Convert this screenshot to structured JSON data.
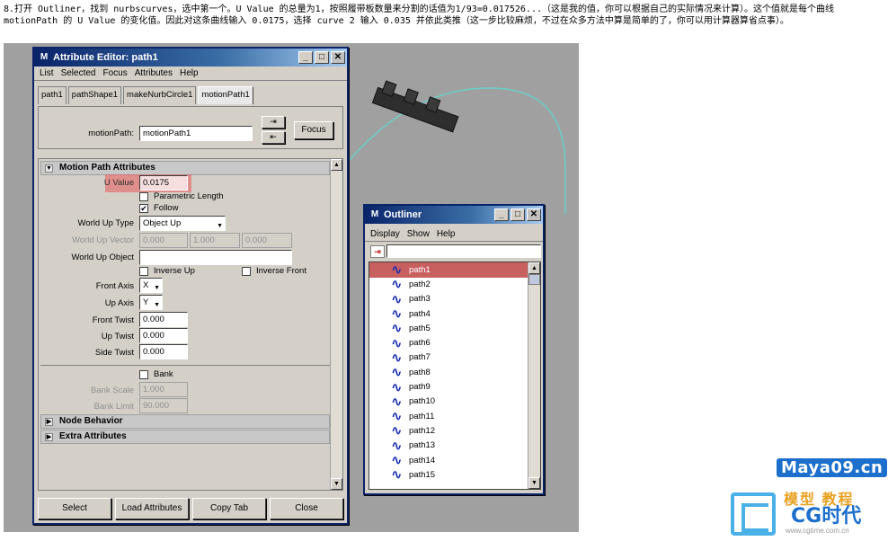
{
  "intro_text": "8.打开 Outliner，找到 nurbscurves，选中第一个。U Value 的总量为1，按照履带板数量来分割的话值为1/93=0.017526...（这是我的值，你可以根据自己的实际情况来计算）。这个值就是每个曲线 motionPath 的 U Value 的变化值。因此对这条曲线输入 0.0175，选择 curve 2 输入 0.035 并依此类推（这一步比较麻烦，不过在众多方法中算是简单的了，你可以用计算器算省点事）。",
  "attr_editor": {
    "title": "Attribute Editor: path1",
    "menu": [
      "List",
      "Selected",
      "Focus",
      "Attributes",
      "Help"
    ],
    "tabs": [
      "path1",
      "pathShape1",
      "makeNurbCircle1",
      "motionPath1"
    ],
    "active_tab": "motionPath1",
    "motion_path_label": "motionPath:",
    "motion_path_value": "motionPath1",
    "focus_button": "Focus",
    "section_motion": "Motion Path Attributes",
    "u_value_label": "U Value",
    "u_value": "0.0175",
    "parametric_length": "Parametric Length",
    "follow": "Follow",
    "world_up_type_label": "World Up Type",
    "world_up_type_value": "Object Up",
    "world_up_vector_label": "World Up Vector",
    "world_up_vector": [
      "0.000",
      "1.000",
      "0.000"
    ],
    "world_up_object_label": "World Up Object",
    "inverse_up": "Inverse Up",
    "inverse_front": "Inverse Front",
    "front_axis_label": "Front Axis",
    "front_axis_value": "X",
    "up_axis_label": "Up Axis",
    "up_axis_value": "Y",
    "front_twist_label": "Front Twist",
    "front_twist": "0.000",
    "up_twist_label": "Up Twist",
    "up_twist": "0.000",
    "side_twist_label": "Side Twist",
    "side_twist": "0.000",
    "bank": "Bank",
    "bank_scale_label": "Bank Scale",
    "bank_scale": "1.000",
    "bank_limit_label": "Bank Limit",
    "bank_limit": "90.000",
    "section_node": "Node Behavior",
    "section_extra": "Extra Attributes",
    "buttons": [
      "Select",
      "Load Attributes",
      "Copy Tab",
      "Close"
    ]
  },
  "outliner": {
    "title": "Outliner",
    "menu": [
      "Display",
      "Show",
      "Help"
    ],
    "items": [
      "path1",
      "path2",
      "path3",
      "path4",
      "path5",
      "path6",
      "path7",
      "path8",
      "path9",
      "path10",
      "path11",
      "path12",
      "path13",
      "path14",
      "path15"
    ],
    "selected": "path1"
  },
  "watermark": {
    "site": "Maya09.cn",
    "slogan": "模型 教程",
    "brand": "CG时代",
    "url": "www.cgtime.com.cn"
  },
  "colors": {
    "highlight": "#e65a5a",
    "titlebar": "#0a246a",
    "viewport": "#a0a0a0",
    "curve": "#6ad0c8"
  }
}
